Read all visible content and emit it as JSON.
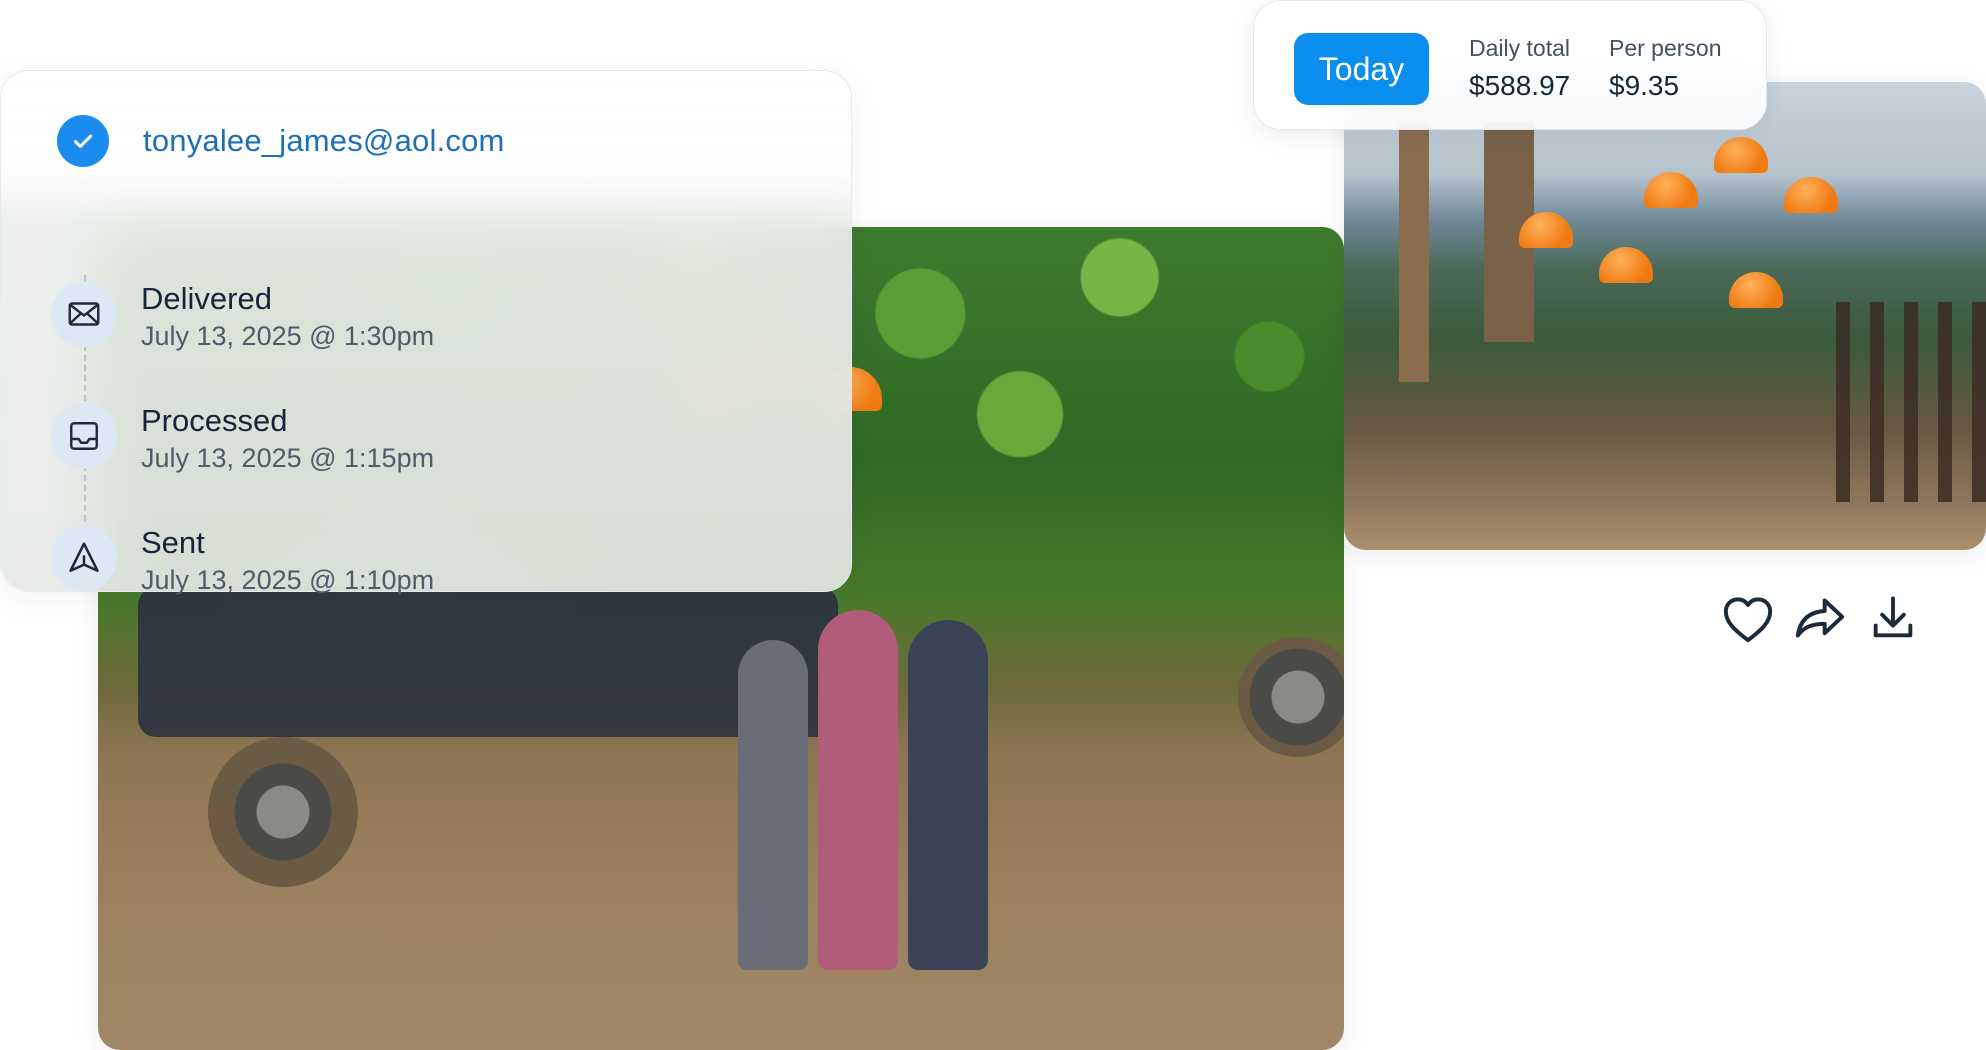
{
  "notification": {
    "email": "tonyalee_james@aol.com",
    "timeline": [
      {
        "status": "Delivered",
        "time": "July 13, 2025 @ 1:30pm",
        "icon": "envelope-icon"
      },
      {
        "status": "Processed",
        "time": "July 13, 2025 @ 1:15pm",
        "icon": "inbox-icon"
      },
      {
        "status": "Sent",
        "time": "July 13, 2025 @ 1:10pm",
        "icon": "send-icon"
      }
    ]
  },
  "cost": {
    "period_button": "Today",
    "daily_total_label": "Daily total",
    "daily_total_value": "$588.97",
    "per_person_label": "Per person",
    "per_person_value": "$9.35"
  },
  "photo_actions": [
    "heart-icon",
    "share-icon",
    "download-icon"
  ],
  "colors": {
    "accent": "#0a8fef",
    "email_link": "#1f6fb8",
    "timeline_icon_bg": "#dce8f4",
    "text_dark": "#16263a",
    "text_muted": "#4e5c6b"
  }
}
